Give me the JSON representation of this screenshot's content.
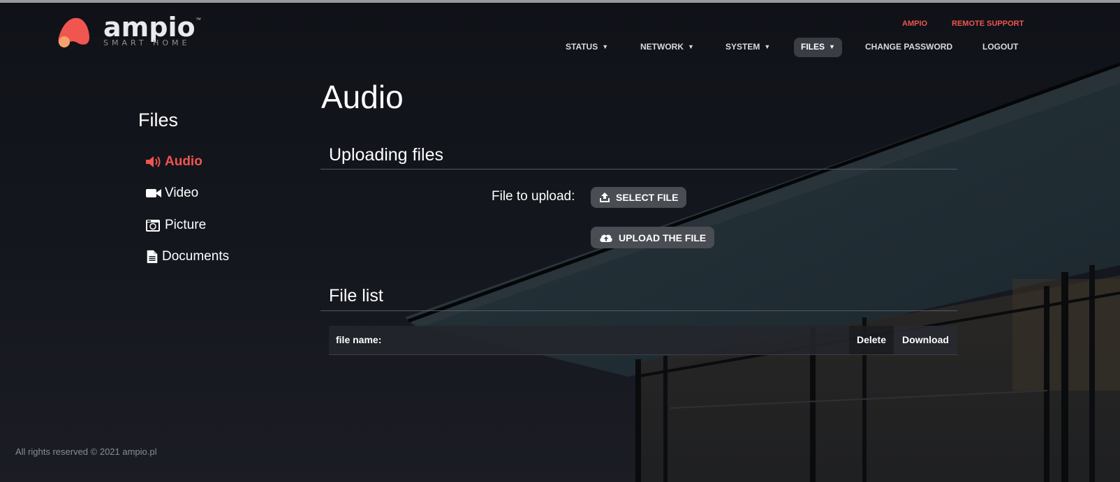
{
  "brand": {
    "logo_text": "ampio",
    "logo_sub": "SMART HOME",
    "tm": "™",
    "accent_color": "#f0554f"
  },
  "toplinks": {
    "ampio": "AMPIO",
    "remote_support": "REMOTE SUPPORT"
  },
  "nav": {
    "status": "STATUS",
    "network": "NETWORK",
    "system": "SYSTEM",
    "files": "FILES",
    "change_password": "CHANGE PASSWORD",
    "logout": "LOGOUT",
    "caret": "▼"
  },
  "sidebar": {
    "title": "Files",
    "items": [
      {
        "label": "Audio",
        "icon": "speaker-icon",
        "active": true
      },
      {
        "label": "Video",
        "icon": "video-camera-icon",
        "active": false
      },
      {
        "label": "Picture",
        "icon": "photo-camera-icon",
        "active": false
      },
      {
        "label": "Documents",
        "icon": "document-icon",
        "active": false
      }
    ]
  },
  "main": {
    "title": "Audio",
    "upload_section": "Uploading files",
    "file_to_upload_label": "File to upload:",
    "select_file_button": "SELECT FILE",
    "upload_button": "UPLOAD THE FILE",
    "file_list_section": "File list",
    "table": {
      "col_name": "file name:",
      "col_delete": "Delete",
      "col_download": "Download"
    }
  },
  "footer": "All rights reserved © 2021 ampio.pl"
}
